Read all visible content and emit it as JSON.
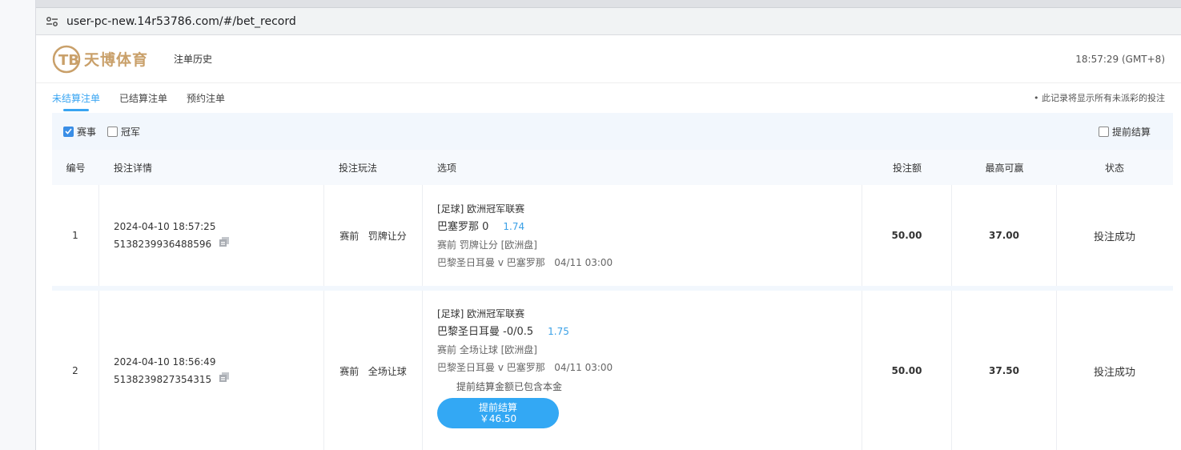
{
  "browser": {
    "url": "user-pc-new.14r53786.com/#/bet_record"
  },
  "header": {
    "logo_text": "天博体育",
    "page_title": "注单历史",
    "clock": "18:57:29 (GMT+8)"
  },
  "tabs": [
    {
      "label": "未结算注单",
      "active": true
    },
    {
      "label": "已结算注单",
      "active": false
    },
    {
      "label": "预约注单",
      "active": false
    }
  ],
  "tab_note": "• 此记录将显示所有未派彩的投注",
  "filters": {
    "event": {
      "label": "赛事",
      "checked": true
    },
    "champion": {
      "label": "冠军",
      "checked": false
    },
    "early_settle": {
      "label": "提前结算",
      "checked": false
    }
  },
  "columns": [
    "编号",
    "投注详情",
    "投注玩法",
    "选项",
    "投注额",
    "最高可赢",
    "状态"
  ],
  "bets": [
    {
      "no": "1",
      "datetime": "2024-04-10 18:57:25",
      "order_id": "5138239936488596",
      "play_stage": "赛前",
      "play_type": "罚牌让分",
      "league": "[足球] 欧洲冠军联赛",
      "selection": "巴塞罗那 0",
      "odds": "1.74",
      "market": "赛前 罚牌让分 [欧洲盘]",
      "match": "巴黎圣日耳曼 v 巴塞罗那",
      "match_time": "04/11 03:00",
      "stake": "50.00",
      "max_win": "37.00",
      "status": "投注成功"
    },
    {
      "no": "2",
      "datetime": "2024-04-10 18:56:49",
      "order_id": "5138239827354315",
      "play_stage": "赛前",
      "play_type": "全场让球",
      "league": "[足球] 欧洲冠军联赛",
      "selection": "巴黎圣日耳曼 -0/0.5",
      "odds": "1.75",
      "market": "赛前 全场让球 [欧洲盘]",
      "match": "巴黎圣日耳曼 v 巴塞罗那",
      "match_time": "04/11 03:00",
      "settle_note": "提前结算金额已包含本金",
      "settle_label": "提前结算",
      "settle_amount": "￥46.50",
      "stake": "50.00",
      "max_win": "37.50",
      "status": "投注成功"
    }
  ],
  "colors": {
    "accent": "#39a5f2",
    "button": "#33a8f4",
    "logo": "#c9a06a"
  }
}
